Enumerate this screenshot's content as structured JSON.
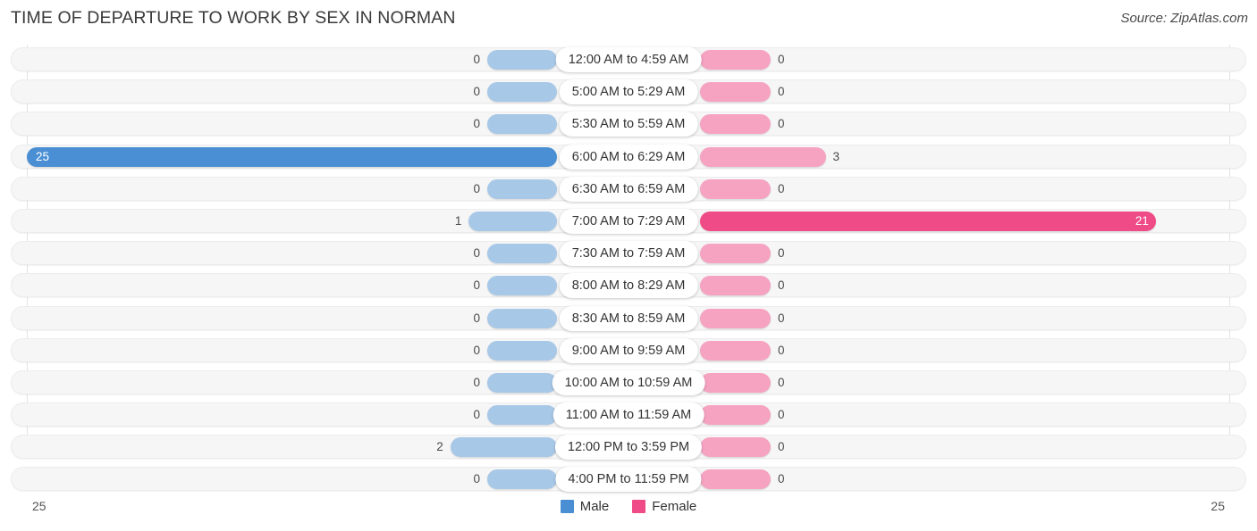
{
  "header": {
    "title": "TIME OF DEPARTURE TO WORK BY SEX IN NORMAN",
    "source": "Source: ZipAtlas.com"
  },
  "legend": {
    "male_label": "Male",
    "female_label": "Female",
    "male_color": "#4a8fd4",
    "female_color": "#ef4b86"
  },
  "axis": {
    "min_label": "25",
    "max_label": "25"
  },
  "chart_data": {
    "type": "bar",
    "title": "TIME OF DEPARTURE TO WORK BY SEX IN NORMAN",
    "subtitle": "Source: ZipAtlas.com",
    "orientation": "horizontal-diverging",
    "xlabel": "",
    "ylabel": "",
    "xlim": [
      25,
      25
    ],
    "grid": true,
    "legend_position": "bottom-center",
    "categories": [
      "12:00 AM to 4:59 AM",
      "5:00 AM to 5:29 AM",
      "5:30 AM to 5:59 AM",
      "6:00 AM to 6:29 AM",
      "6:30 AM to 6:59 AM",
      "7:00 AM to 7:29 AM",
      "7:30 AM to 7:59 AM",
      "8:00 AM to 8:29 AM",
      "8:30 AM to 8:59 AM",
      "9:00 AM to 9:59 AM",
      "10:00 AM to 10:59 AM",
      "11:00 AM to 11:59 AM",
      "12:00 PM to 3:59 PM",
      "4:00 PM to 11:59 PM"
    ],
    "series": [
      {
        "name": "Male",
        "color": "#4a8fd4",
        "values": [
          0,
          0,
          0,
          25,
          0,
          1,
          0,
          0,
          0,
          0,
          0,
          0,
          2,
          0
        ]
      },
      {
        "name": "Female",
        "color": "#ef4b86",
        "values": [
          0,
          0,
          0,
          3,
          0,
          21,
          0,
          0,
          0,
          0,
          0,
          0,
          0,
          0
        ]
      }
    ],
    "value_labels": {
      "male": [
        "0",
        "0",
        "0",
        "25",
        "0",
        "1",
        "0",
        "0",
        "0",
        "0",
        "0",
        "0",
        "2",
        "0"
      ],
      "female": [
        "0",
        "0",
        "0",
        "3",
        "0",
        "21",
        "0",
        "0",
        "0",
        "0",
        "0",
        "0",
        "0",
        "0"
      ]
    }
  }
}
